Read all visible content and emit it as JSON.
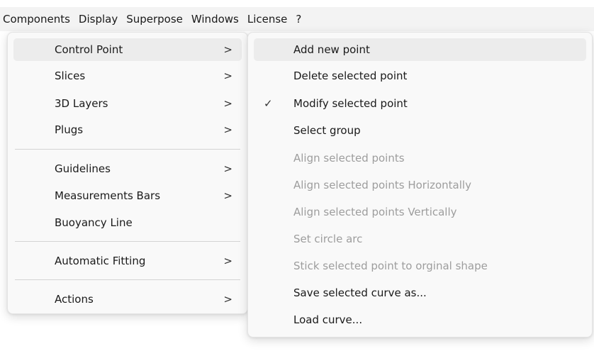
{
  "menubar": {
    "items": [
      "Components",
      "Display",
      "Superpose",
      "Windows",
      "License",
      "?"
    ]
  },
  "components_menu": {
    "items": [
      {
        "label": "Control Point",
        "submenu": true
      },
      {
        "label": "Slices",
        "submenu": true
      },
      {
        "label": "3D Layers",
        "submenu": true
      },
      {
        "label": "Plugs",
        "submenu": true
      },
      {
        "label": "Guidelines",
        "submenu": true
      },
      {
        "label": "Measurements Bars",
        "submenu": true
      },
      {
        "label": "Buoyancy Line",
        "submenu": false
      },
      {
        "label": "Automatic Fitting",
        "submenu": true
      },
      {
        "label": "Actions",
        "submenu": true
      }
    ],
    "arrow_glyph": ">"
  },
  "control_point_menu": {
    "items": [
      {
        "label": "Add new point",
        "enabled": true,
        "checked": false
      },
      {
        "label": "Delete selected point",
        "enabled": true,
        "checked": false
      },
      {
        "label": "Modify selected point",
        "enabled": true,
        "checked": true
      },
      {
        "label": "Select group",
        "enabled": true,
        "checked": false
      },
      {
        "label": "Align selected points",
        "enabled": false,
        "checked": false
      },
      {
        "label": "Align selected points Horizontally",
        "enabled": false,
        "checked": false
      },
      {
        "label": "Align selected points Vertically",
        "enabled": false,
        "checked": false
      },
      {
        "label": "Set circle arc",
        "enabled": false,
        "checked": false
      },
      {
        "label": "Stick selected point to orginal shape",
        "enabled": false,
        "checked": false
      },
      {
        "label": "Save selected curve as...",
        "enabled": true,
        "checked": false
      },
      {
        "label": "Load curve...",
        "enabled": true,
        "checked": false
      }
    ],
    "check_glyph": "✓"
  },
  "colors": {
    "menu_bg": "#f9f9f9",
    "highlight_bg": "#ececec",
    "disabled_text": "#9d9d9d",
    "menubar_bg": "#f3f3f3"
  }
}
